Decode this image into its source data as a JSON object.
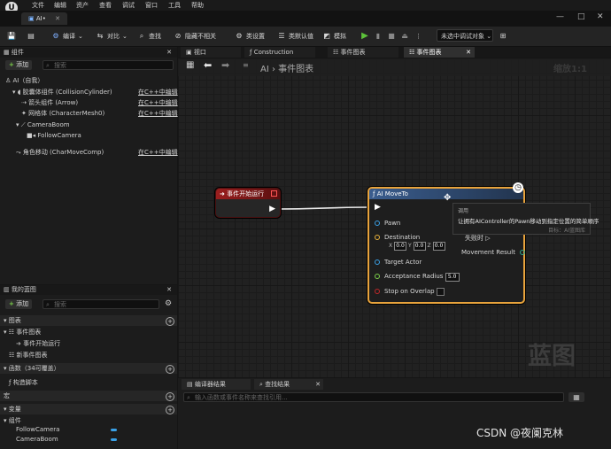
{
  "menu": [
    "文件",
    "编辑",
    "资产",
    "查看",
    "调试",
    "窗口",
    "工具",
    "帮助"
  ],
  "doc_tab": "AI•",
  "window_buttons": [
    "—",
    "□",
    "✕"
  ],
  "toolbar": {
    "compile": "编译",
    "diff": "对比",
    "find": "查找",
    "hide_unrelated": "隐藏不相关",
    "class_settings": "类设置",
    "class_defaults": "类默认值",
    "simulate": "模拟",
    "debug_target": "未选中调试对象"
  },
  "components_panel": {
    "title": "组件",
    "add": "添加",
    "search_placeholder": "搜索",
    "root": "AI（自我）",
    "items": [
      {
        "label": "胶囊体组件 (CollisionCylinder)",
        "action": "在C++中编辑"
      },
      {
        "label": "箭头组件 (Arrow)",
        "action": "在C++中编辑"
      },
      {
        "label": "网格体 (CharacterMesh0)",
        "action": "在C++中编辑"
      },
      {
        "label": "CameraBoom",
        "action": ""
      },
      {
        "label": "FollowCamera",
        "action": ""
      },
      {
        "label": "角色移动 (CharMoveComp)",
        "action": "在C++中编辑"
      }
    ]
  },
  "my_blueprint": {
    "title": "我的蓝图",
    "add": "添加",
    "search_placeholder": "搜索",
    "graphs_header": "图表",
    "event_graph": "事件图表",
    "event_begin_play": "事件开始运行",
    "new_event_graph": "新事件图表",
    "functions_header": "函数（34可覆盖）",
    "construction_script": "构造脚本",
    "macros_header": "宏",
    "variables_header": "变量",
    "components_cat": "组件",
    "variables": [
      "FollowCamera",
      "CameraBoom"
    ]
  },
  "graph_tabs": [
    "视口",
    "Construction Scr...",
    "事件图表",
    "事件图表"
  ],
  "breadcrumb": {
    "root": "AI",
    "current": "事件图表"
  },
  "zoom": "缩放1:1",
  "watermark": "蓝图",
  "begin_node": {
    "title": "事件开始运行"
  },
  "moveto_node": {
    "title": "AI MoveTo",
    "pins_left": [
      "Pawn",
      "Destination",
      "Target Actor",
      "Acceptance Radius",
      "Stop on Overlap"
    ],
    "dest_axes": [
      "X",
      "Y",
      "Z"
    ],
    "dest_values": [
      "0.0",
      "0.0",
      "0.0"
    ],
    "acceptance_radius": "5.0",
    "pins_right": [
      "失败时",
      "Movement Result"
    ]
  },
  "tooltip": {
    "heading": "调用",
    "text": "让拥有AIController的Pawn移动到指定位置的简单顺序",
    "sub": "目标：AI蓝图库"
  },
  "bottom": {
    "tabs": [
      "编译器结果",
      "查找结果"
    ],
    "search_placeholder": "输入函数或事件名称来查找引用..."
  },
  "credit": "CSDN @夜阑克林",
  "colors": {
    "accent": "#e8a33c",
    "event_red": "#8c1c1c",
    "node_blue": "#2e4e7a",
    "var_blue": "#3aa0e6",
    "play_green": "#5cc23a"
  }
}
